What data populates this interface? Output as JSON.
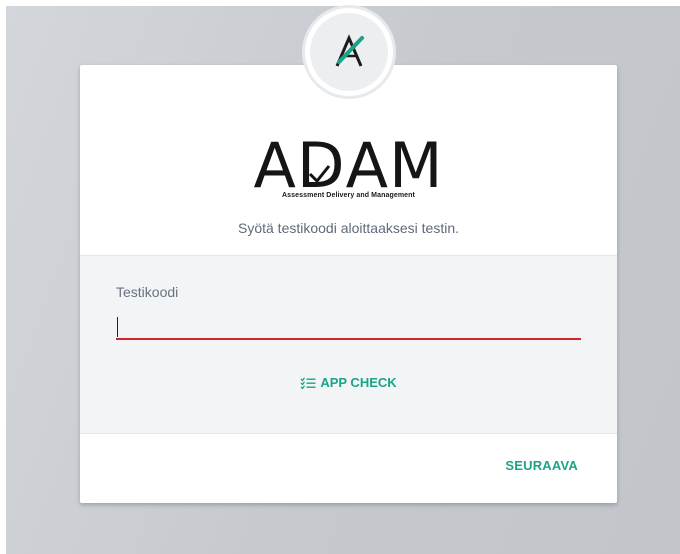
{
  "brand": {
    "title_letters": [
      "A",
      "D",
      "A",
      "M"
    ],
    "tagline": "Assessment Delivery and Management",
    "accent_color": "#1ba389",
    "logo_icon": "adam-check-logo-icon"
  },
  "intro": {
    "subtitle": "Syötä testikoodi aloittaaksesi testin."
  },
  "form": {
    "code_label": "Testikoodi",
    "code_value": "",
    "code_placeholder": "",
    "underline_color": "#d2242a"
  },
  "actions": {
    "app_check_label": "APP CHECK",
    "app_check_icon": "checklist-icon",
    "next_label": "SEURAAVA"
  }
}
